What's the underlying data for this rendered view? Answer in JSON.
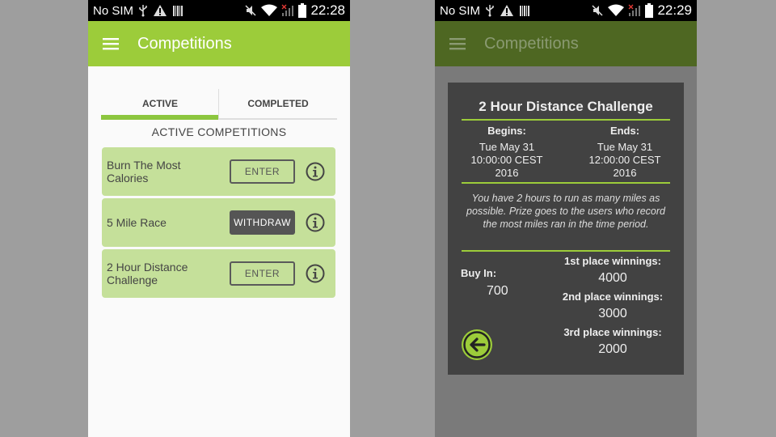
{
  "colors": {
    "accent": "#9ccc3a",
    "accent_dark": "#4e6722",
    "card_bg": "#c5e09a",
    "dialog_bg": "#424242"
  },
  "left_screen": {
    "status": {
      "carrier": "No SIM",
      "time": "22:28",
      "icons": [
        "usb-icon",
        "warning-icon",
        "barcode-icon",
        "mute-icon",
        "wifi-icon",
        "signal-icon",
        "battery-icon"
      ]
    },
    "appbar": {
      "title": "Competitions",
      "menu_icon": "menu-icon"
    },
    "tabs": [
      {
        "label": "ACTIVE",
        "active": true
      },
      {
        "label": "COMPLETED",
        "active": false
      }
    ],
    "section_title": "ACTIVE COMPETITIONS",
    "competitions": [
      {
        "name": "Burn The Most Calories",
        "button": "ENTER"
      },
      {
        "name": "5 Mile Race",
        "button": "WITHDRAW"
      },
      {
        "name": "2 Hour Distance Challenge",
        "button": "ENTER"
      }
    ]
  },
  "right_screen": {
    "status": {
      "carrier": "No SIM",
      "time": "22:29"
    },
    "appbar": {
      "title": "Competitions"
    },
    "dialog": {
      "title": "2 Hour Distance Challenge",
      "begins_label": "Begins:",
      "begins_value": "Tue May 31 10:00:00 CEST 2016",
      "ends_label": "Ends:",
      "ends_value": "Tue May 31 12:00:00 CEST 2016",
      "description": "You have 2 hours to run as many miles as possible. Prize goes to the users who record the most miles ran in the time period.",
      "buy_in_label": "Buy In:",
      "buy_in_value": "700",
      "prizes": [
        {
          "label": "1st place winnings:",
          "value": "4000"
        },
        {
          "label": "2nd place winnings:",
          "value": "3000"
        },
        {
          "label": "3rd place winnings:",
          "value": "2000"
        }
      ]
    }
  }
}
